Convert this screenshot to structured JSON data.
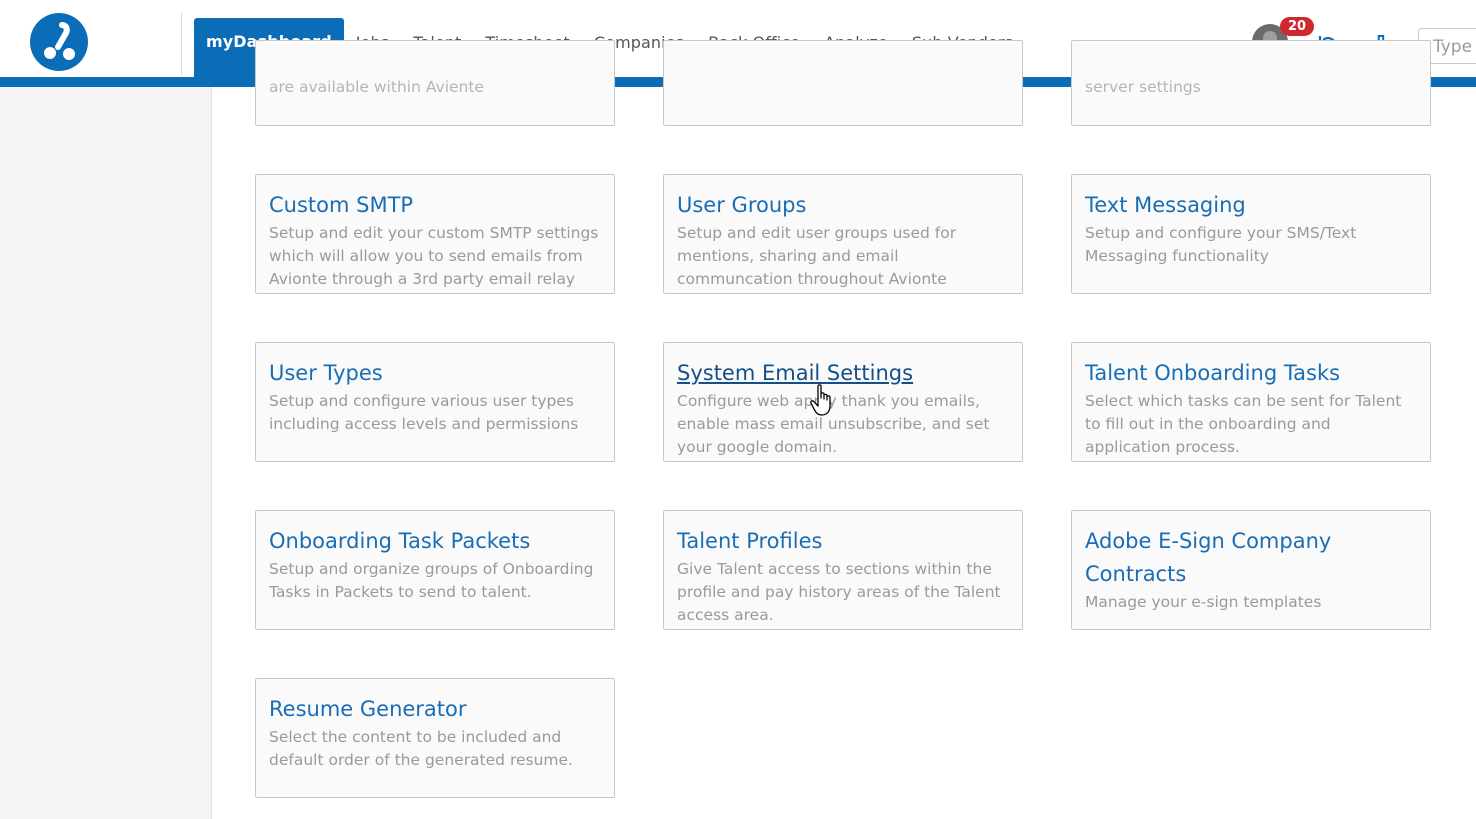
{
  "nav": {
    "items": [
      {
        "label": "myDashboard",
        "active": true
      },
      {
        "label": "Jobs"
      },
      {
        "label": "Talent"
      },
      {
        "label": "Timesheet"
      },
      {
        "label": "Companies"
      },
      {
        "label": "Back Office"
      },
      {
        "label": "Analyze"
      },
      {
        "label": "Sub Vendors"
      }
    ],
    "notification_count": "20",
    "search_placeholder": "Type",
    "icons": [
      "logo-icon",
      "avatar",
      "refresh-icon",
      "analytics-icon"
    ],
    "accent_color": "#0b6cb8",
    "badge_color": "#d0282f"
  },
  "cut_off_row": {
    "col1_text": "are available within Aviente",
    "col3_text": "server settings"
  },
  "cards": [
    {
      "title": "Custom SMTP",
      "desc": "Setup and edit your custom SMTP settings which will allow you to send emails from Avionte through a 3rd party email relay"
    },
    {
      "title": "User Groups",
      "desc": "Setup and edit user groups used for mentions, sharing and email communcation throughout Avionte"
    },
    {
      "title": "Text Messaging",
      "desc": "Setup and configure your SMS/Text Messaging functionality"
    },
    {
      "title": "User Types",
      "desc": "Setup and configure various user types including access levels and permissions"
    },
    {
      "title": "System Email Settings",
      "desc": "Configure web apply thank you emails, enable mass email unsubscribe, and set your google domain."
    },
    {
      "title": "Talent Onboarding Tasks",
      "desc": "Select which tasks can be sent for Talent to fill out in the onboarding and application process."
    },
    {
      "title": "Onboarding Task Packets",
      "desc": "Setup and organize groups of Onboarding Tasks in Packets to send to talent."
    },
    {
      "title": "Talent Profiles",
      "desc": "Give Talent access to sections within the profile and pay history areas of the Talent access area."
    },
    {
      "title": "Adobe E-Sign Company Contracts",
      "desc": "Manage your e-sign templates"
    },
    {
      "title": "Resume Generator",
      "desc": "Select the content to be included and default order of the generated resume."
    }
  ]
}
